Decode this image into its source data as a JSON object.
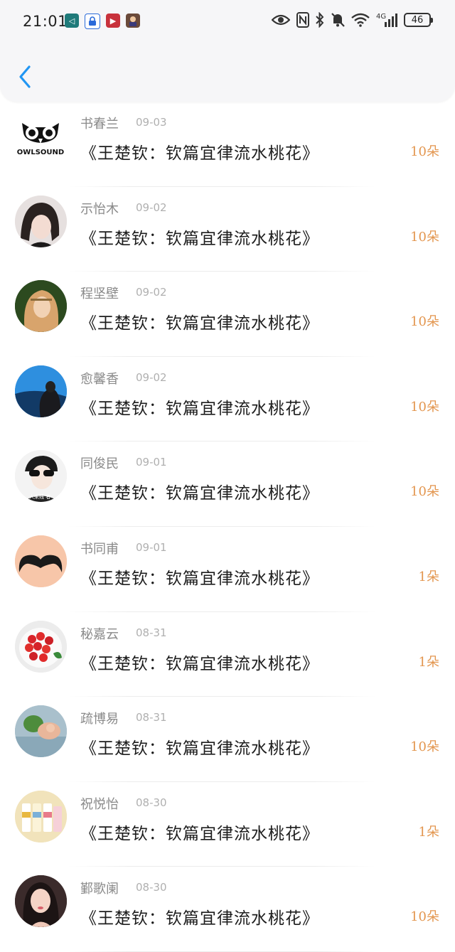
{
  "status_bar": {
    "time": "21:01",
    "battery": "46",
    "network": "4G"
  },
  "nav": {
    "back_icon": "chevron-left-icon"
  },
  "items": [
    {
      "name": "书春兰",
      "date": "09-03",
      "title": "《王楚钦：钦篇宜律流水桃花》",
      "count": "10朵",
      "avatar": "owlsound-logo",
      "avatar_text": "OWLSOUND"
    },
    {
      "name": "示怡木",
      "date": "09-02",
      "title": "《王楚钦：钦篇宜律流水桃花》",
      "count": "10朵",
      "avatar": "portrait-girl"
    },
    {
      "name": "程坚壁",
      "date": "09-02",
      "title": "《王楚钦：钦篇宜律流水桃花》",
      "count": "10朵",
      "avatar": "portrait-blonde"
    },
    {
      "name": "愈馨香",
      "date": "09-02",
      "title": "《王楚钦：钦篇宜律流水桃花》",
      "count": "10朵",
      "avatar": "portrait-blue-sky"
    },
    {
      "name": "同俊民",
      "date": "09-01",
      "title": "《王楚钦：钦篇宜律流水桃花》",
      "count": "10朵",
      "avatar": "portrait-sunglasses",
      "avatar_text": "人来贱 者"
    },
    {
      "name": "书同甫",
      "date": "09-01",
      "title": "《王楚钦：钦篇宜律流水桃花》",
      "count": "1朵",
      "avatar": "mustache"
    },
    {
      "name": "秘嘉云",
      "date": "08-31",
      "title": "《王楚钦：钦篇宜律流水桃花》",
      "count": "1朵",
      "avatar": "tomatoes-bowl"
    },
    {
      "name": "疏博易",
      "date": "08-31",
      "title": "《王楚钦：钦篇宜律流水桃花》",
      "count": "10朵",
      "avatar": "baby-photo"
    },
    {
      "name": "祝悦怡",
      "date": "08-30",
      "title": "《王楚钦：钦篇宜律流水桃花》",
      "count": "1朵",
      "avatar": "candy-box"
    },
    {
      "name": "鄞歌阑",
      "date": "08-30",
      "title": "《王楚钦：钦篇宜律流水桃花》",
      "count": "10朵",
      "avatar": "portrait-woman"
    }
  ],
  "colors": {
    "accent": "#2196f3",
    "count": "#e3964f",
    "name": "#8a8a8a"
  }
}
